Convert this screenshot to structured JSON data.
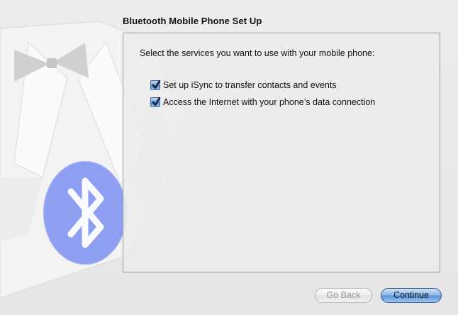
{
  "page": {
    "title": "Bluetooth Mobile Phone Set Up"
  },
  "main": {
    "instructions": "Select the services you want to use with your mobile phone:",
    "options": [
      {
        "label": "Set up iSync to transfer contacts and events",
        "checked": true
      },
      {
        "label": "Access the Internet with your phone’s data connection",
        "checked": true
      }
    ]
  },
  "footer": {
    "back_label": "Go Back",
    "back_enabled": false,
    "continue_label": "Continue"
  },
  "icons": {
    "background": "bluetooth-phone-illustration",
    "checkbox": "checkmark-icon"
  },
  "colors": {
    "accent": "#5b93d6",
    "bluetooth": "#6f83e8"
  }
}
